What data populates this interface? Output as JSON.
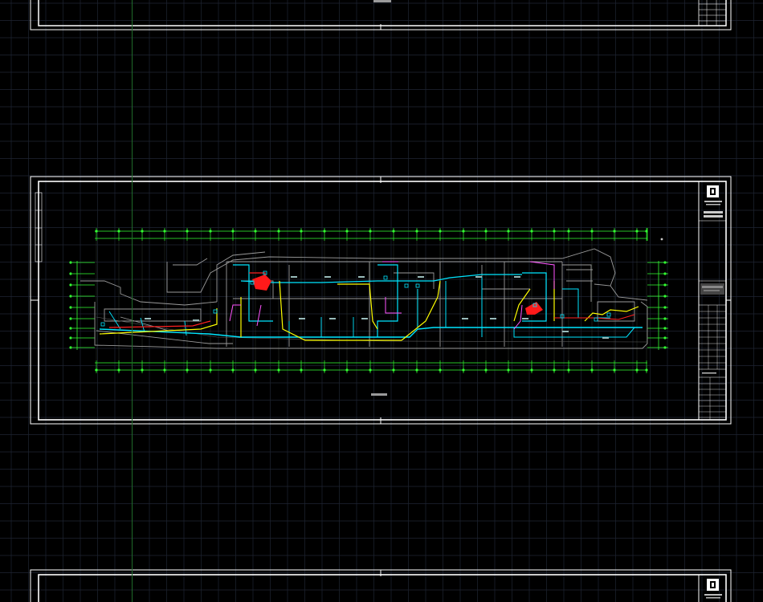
{
  "viewport": {
    "background": "#000000",
    "grid_color": "#1f2533",
    "grid_major_color": "#2a3244",
    "axis_y_color": "#1f6b2a"
  },
  "colors": {
    "frame": "#ffffff",
    "axis_grid": "#33ff33",
    "walls": "#9a9a9a",
    "pipe_cyan": "#00e5ff",
    "pipe_yellow": "#ffff00",
    "pipe_red": "#ff2020",
    "pipe_magenta": "#ff55ff",
    "equipment": "#ff1a1a"
  },
  "sheets": [
    {
      "id": "sheet-top",
      "state": "partial-top"
    },
    {
      "id": "sheet-main",
      "state": "full"
    },
    {
      "id": "sheet-bottom",
      "state": "partial-bottom"
    }
  ],
  "icons": {
    "logo": "company-logo-icon",
    "north": "compass-icon"
  }
}
